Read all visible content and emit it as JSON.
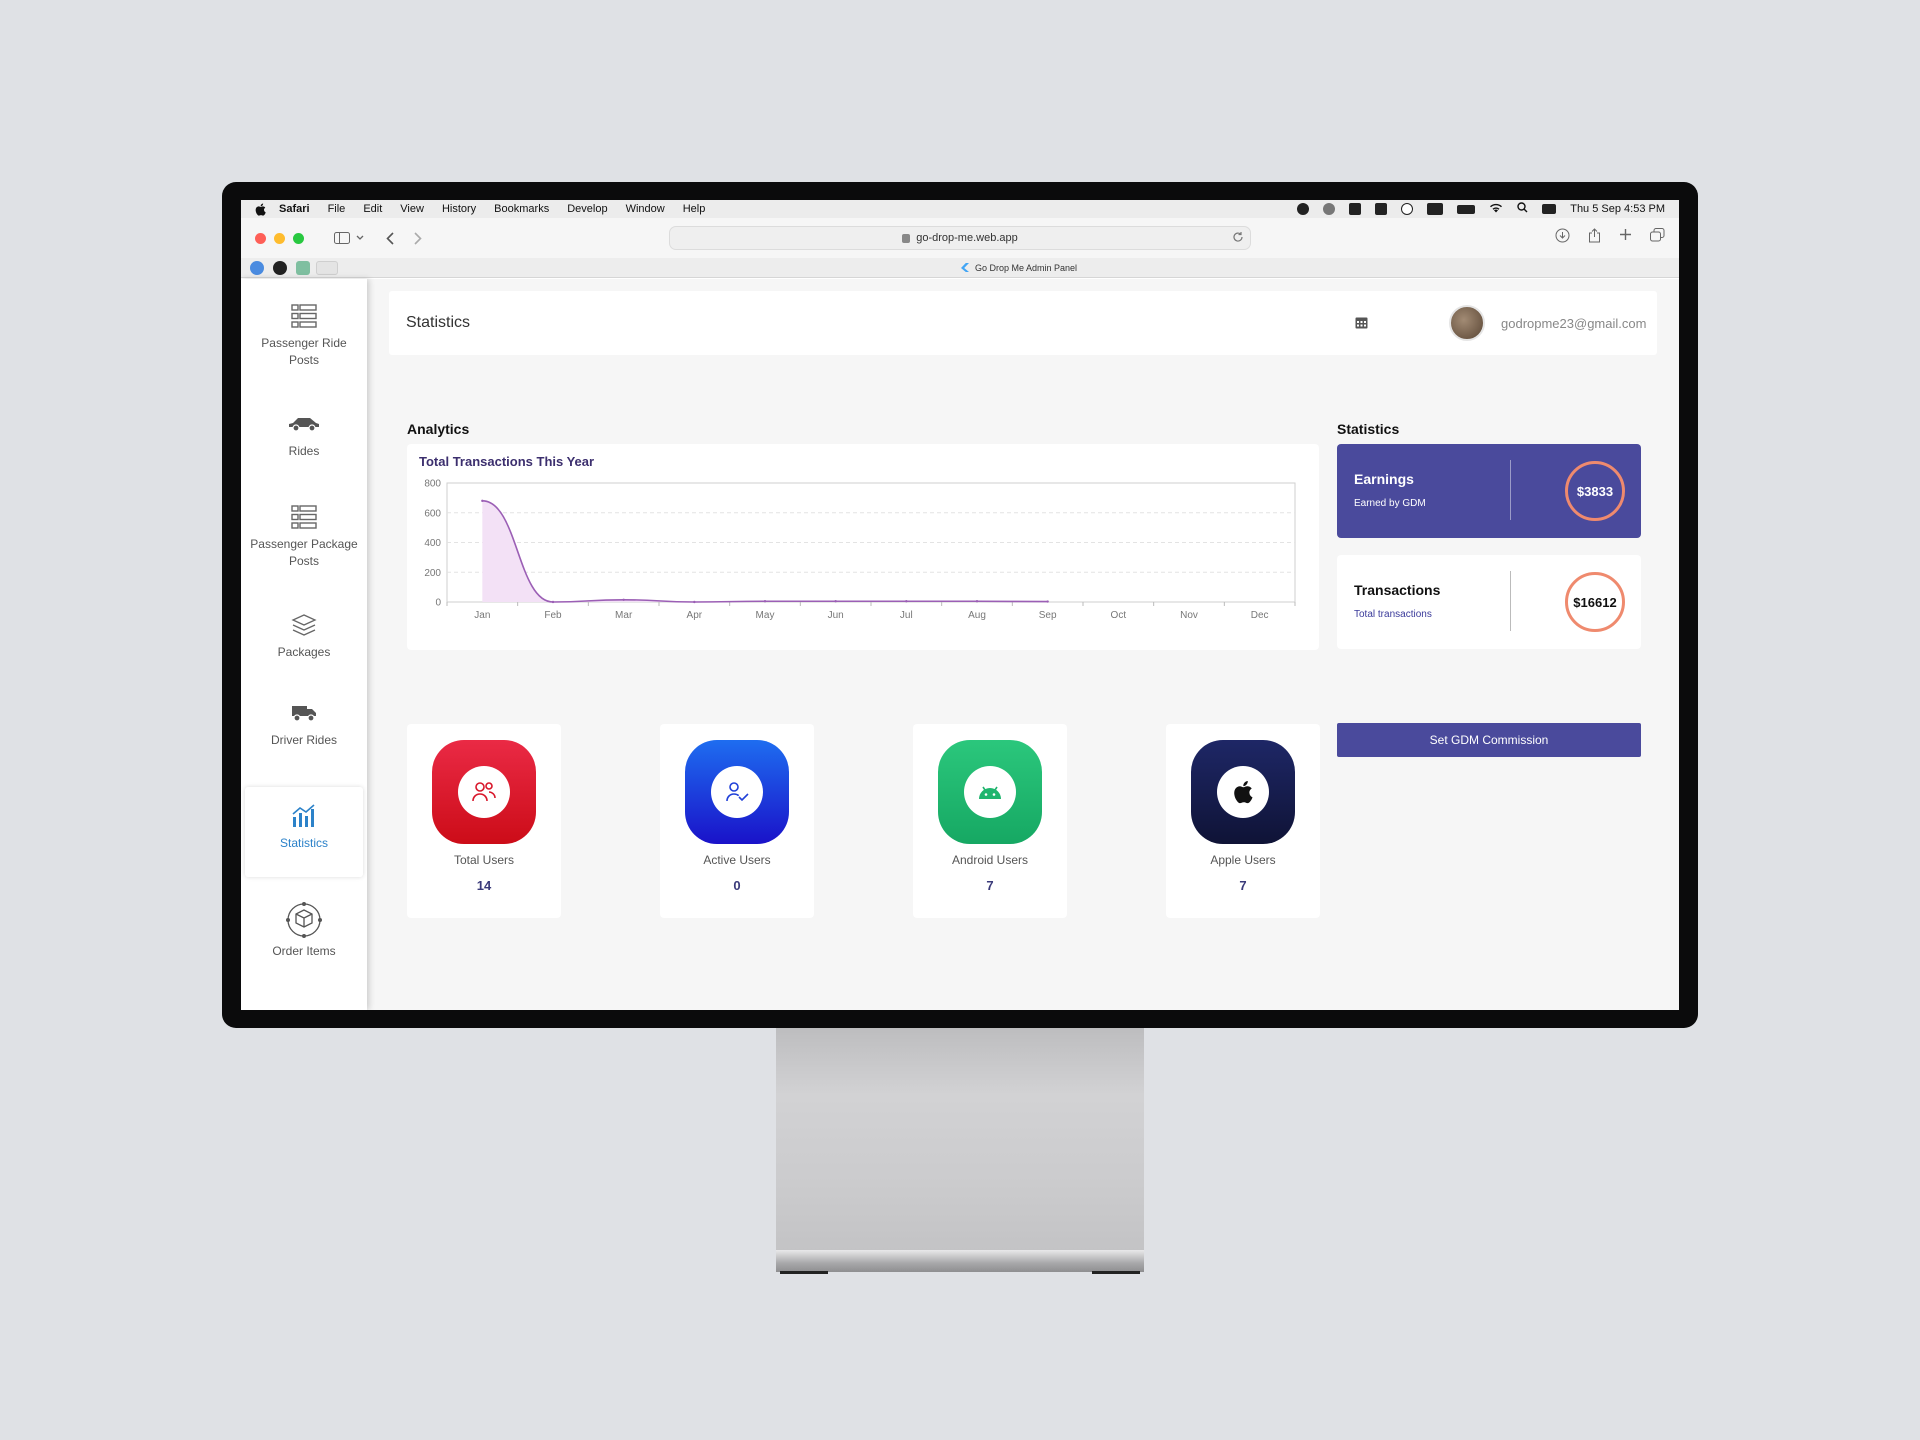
{
  "menubar": {
    "items": [
      "Safari",
      "File",
      "Edit",
      "View",
      "History",
      "Bookmarks",
      "Develop",
      "Window",
      "Help"
    ],
    "clock": "Thu 5 Sep  4:53 PM"
  },
  "browser": {
    "url": "go-drop-me.web.app",
    "tab_title": "Go Drop Me Admin Panel"
  },
  "sidebar": {
    "items": [
      {
        "label": "Passenger Ride Posts",
        "icon": "list-icon"
      },
      {
        "label": "Rides",
        "icon": "car-icon"
      },
      {
        "label": "Passenger Package Posts",
        "icon": "list-icon"
      },
      {
        "label": "Packages",
        "icon": "box-icon"
      },
      {
        "label": "Driver Rides",
        "icon": "van-icon"
      },
      {
        "label": "Statistics",
        "icon": "chart-icon",
        "active": true
      },
      {
        "label": "Order Items",
        "icon": "order-box-icon"
      }
    ]
  },
  "header": {
    "title": "Statistics",
    "email": "godropme23@gmail.com"
  },
  "analytics": {
    "heading": "Analytics",
    "chart_title": "Total Transactions This Year"
  },
  "chart_data": {
    "type": "area",
    "title": "Total Transactions This Year",
    "categories": [
      "Jan",
      "Feb",
      "Mar",
      "Apr",
      "May",
      "Jun",
      "Jul",
      "Aug",
      "Sep",
      "Oct",
      "Nov",
      "Dec"
    ],
    "values": [
      680,
      0,
      15,
      0,
      5,
      5,
      5,
      5,
      3,
      null,
      null,
      null
    ],
    "yticks": [
      0,
      200,
      400,
      600,
      800
    ],
    "ylim": [
      0,
      800
    ],
    "grid": true,
    "color": "#9b5fb5"
  },
  "statistics": {
    "heading": "Statistics",
    "earnings": {
      "title": "Earnings",
      "subtitle": "Earned by GDM",
      "value": "$3833"
    },
    "transactions": {
      "title": "Transactions",
      "subtitle": "Total transactions",
      "value": "$16612"
    },
    "commission_button": "Set GDM Commission"
  },
  "users": [
    {
      "label": "Total Users",
      "value": "14",
      "icon": "users-icon",
      "color": "#d8162a"
    },
    {
      "label": "Active Users",
      "value": "0",
      "icon": "user-check-icon",
      "color": "#2030d8"
    },
    {
      "label": "Android Users",
      "value": "7",
      "icon": "android-icon",
      "color": "#1fb56e"
    },
    {
      "label": "Apple Users",
      "value": "7",
      "icon": "apple-icon",
      "color": "#151a4a"
    }
  ]
}
